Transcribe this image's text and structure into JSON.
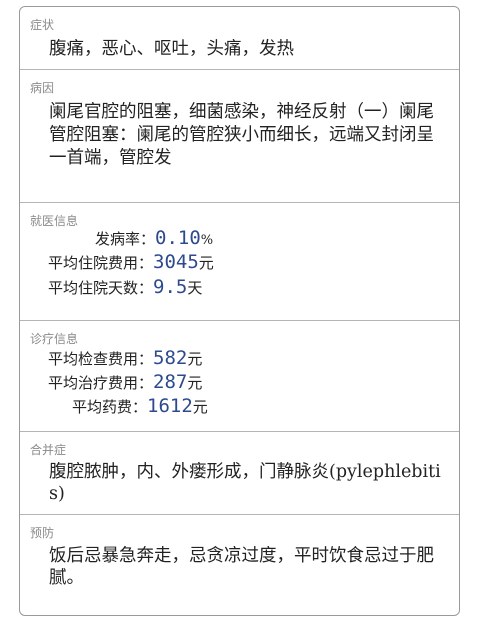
{
  "symptoms": {
    "title": "症状",
    "text": "腹痛，恶心、呕吐，头痛，发热"
  },
  "cause": {
    "title": "病因",
    "text": "阑尾官腔的阻塞，细菌感染，神经反射（一）阑尾管腔阻塞：阑尾的管腔狭小而细长，远端又封闭呈一首端，管腔发"
  },
  "medical": {
    "title": "就医信息",
    "rows": [
      {
        "label": "发病率：",
        "value": "0.10",
        "unit": "%"
      },
      {
        "label": "平均住院费用：",
        "value": "3045",
        "unit": "元"
      },
      {
        "label": "平均住院天数：",
        "value": "9.5",
        "unit": "天"
      }
    ]
  },
  "treatment": {
    "title": "诊疗信息",
    "rows": [
      {
        "label": "平均检查费用：",
        "value": "582",
        "unit": "元"
      },
      {
        "label": "平均治疗费用：",
        "value": "287",
        "unit": "元"
      },
      {
        "label": "平均药费：",
        "value": "1612",
        "unit": "元"
      }
    ]
  },
  "complications": {
    "title": "合并症",
    "text": "腹腔脓肿，内、外瘘形成，门静脉炎(pylephlebitis)"
  },
  "prevention": {
    "title": "预防",
    "text": "饭后忌暴急奔走，忌贪凉过度，平时饮食忌过于肥腻。"
  }
}
